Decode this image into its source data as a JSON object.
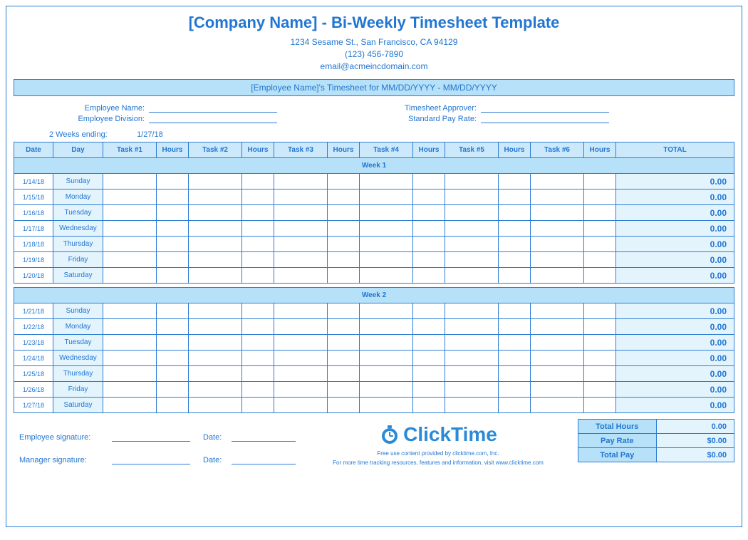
{
  "header": {
    "title": "[Company Name] - Bi-Weekly Timesheet Template",
    "address": "1234 Sesame St., San Francisco, CA 94129",
    "phone": "(123) 456-7890",
    "email": "email@acmeincdomain.com"
  },
  "bar": "[Employee Name]'s Timesheet for MM/DD/YYYY - MM/DD/YYYY",
  "meta": {
    "emp_name_lbl": "Employee Name:",
    "emp_div_lbl": "Employee Division:",
    "approver_lbl": "Timesheet Approver:",
    "payrate_lbl": "Standard Pay Rate:"
  },
  "ending": {
    "label": "2 Weeks ending:",
    "value": "1/27/18"
  },
  "cols": {
    "date": "Date",
    "day": "Day",
    "t1": "Task #1",
    "h": "Hours",
    "t2": "Task #2",
    "t3": "Task #3",
    "t4": "Task #4",
    "t5": "Task #5",
    "t6": "Task #6",
    "total": "TOTAL"
  },
  "weeks": [
    {
      "label": "Week 1",
      "days": [
        {
          "date": "1/14/18",
          "day": "Sunday",
          "total": "0.00"
        },
        {
          "date": "1/15/18",
          "day": "Monday",
          "total": "0.00"
        },
        {
          "date": "1/16/18",
          "day": "Tuesday",
          "total": "0.00"
        },
        {
          "date": "1/17/18",
          "day": "Wednesday",
          "total": "0.00"
        },
        {
          "date": "1/18/18",
          "day": "Thursday",
          "total": "0.00"
        },
        {
          "date": "1/19/18",
          "day": "Friday",
          "total": "0.00"
        },
        {
          "date": "1/20/18",
          "day": "Saturday",
          "total": "0.00"
        }
      ]
    },
    {
      "label": "Week 2",
      "days": [
        {
          "date": "1/21/18",
          "day": "Sunday",
          "total": "0.00"
        },
        {
          "date": "1/22/18",
          "day": "Monday",
          "total": "0.00"
        },
        {
          "date": "1/23/18",
          "day": "Tuesday",
          "total": "0.00"
        },
        {
          "date": "1/24/18",
          "day": "Wednesday",
          "total": "0.00"
        },
        {
          "date": "1/25/18",
          "day": "Thursday",
          "total": "0.00"
        },
        {
          "date": "1/26/18",
          "day": "Friday",
          "total": "0.00"
        },
        {
          "date": "1/27/18",
          "day": "Saturday",
          "total": "0.00"
        }
      ]
    }
  ],
  "sigs": {
    "emp": "Employee signature:",
    "mgr": "Manager signature:",
    "date": "Date:"
  },
  "brand": {
    "name": "ClickTime",
    "fine1": "Free use content provided by clicktime.com, Inc.",
    "fine2": "For more time tracking resources, features and information, visit www.clicktime.com"
  },
  "summary": {
    "hours_lbl": "Total Hours",
    "hours": "0.00",
    "rate_lbl": "Pay Rate",
    "rate": "$0.00",
    "pay_lbl": "Total Pay",
    "pay": "$0.00"
  }
}
